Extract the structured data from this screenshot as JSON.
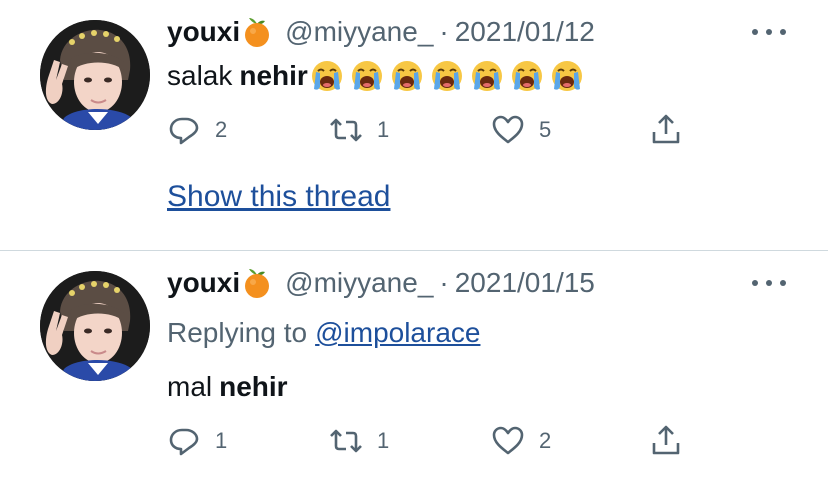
{
  "tweets": [
    {
      "display_name": "youxi",
      "name_emoji": "tangerine-icon",
      "handle": "@miyyane_",
      "separator": "·",
      "date": "2021/01/12",
      "text_plain": "salak",
      "text_bold": "nehir",
      "emojis": [
        "loudly-crying-face-icon",
        "loudly-crying-face-icon",
        "loudly-crying-face-icon",
        "loudly-crying-face-icon",
        "loudly-crying-face-icon",
        "loudly-crying-face-icon",
        "loudly-crying-face-icon"
      ],
      "reply_count": "2",
      "retweet_count": "1",
      "like_count": "5",
      "show_thread_label": "Show this thread"
    },
    {
      "display_name": "youxi",
      "name_emoji": "tangerine-icon",
      "handle": "@miyyane_",
      "separator": "·",
      "date": "2021/01/15",
      "replying_to_label": "Replying to",
      "replying_to_handle": "@impolarace",
      "text_plain": "mal",
      "text_bold": "nehir",
      "reply_count": "1",
      "retweet_count": "1",
      "like_count": "2"
    }
  ],
  "colors": {
    "primary_text": "#0f1419",
    "secondary_text": "#536471",
    "link": "#1d4f9b",
    "divider": "#cfd9de"
  }
}
